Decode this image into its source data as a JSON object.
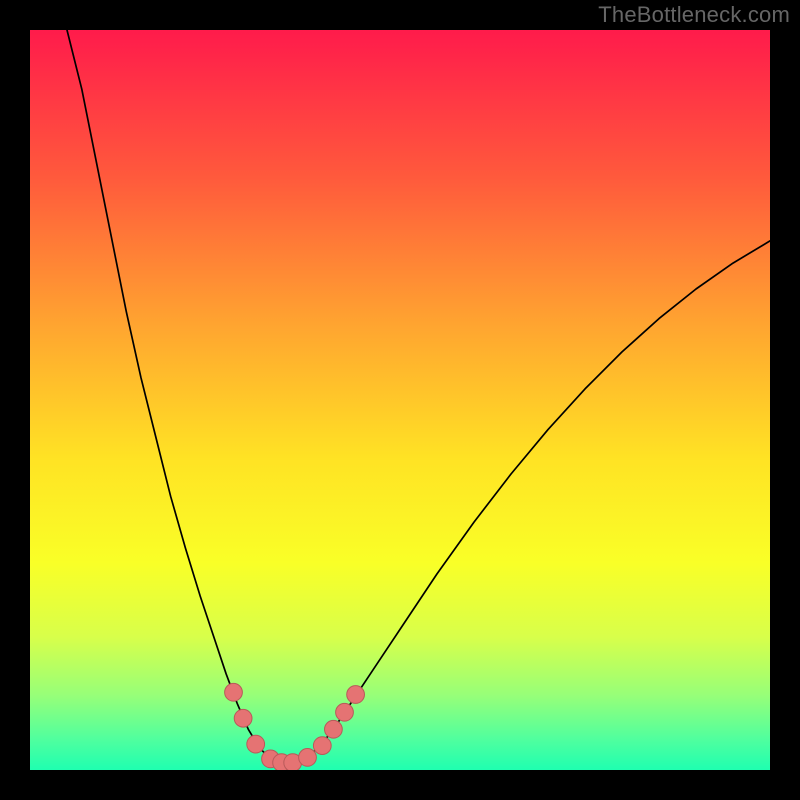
{
  "watermark": "TheBottleneck.com",
  "chart_data": {
    "type": "line",
    "title": "",
    "xlabel": "",
    "ylabel": "",
    "xlim": [
      0,
      100
    ],
    "ylim": [
      0,
      100
    ],
    "grid": false,
    "legend": false,
    "background_gradient": {
      "stops": [
        {
          "offset": 0.0,
          "color": "#ff1b4b"
        },
        {
          "offset": 0.2,
          "color": "#ff5a3c"
        },
        {
          "offset": 0.4,
          "color": "#ffa530"
        },
        {
          "offset": 0.58,
          "color": "#ffe324"
        },
        {
          "offset": 0.72,
          "color": "#f9ff27"
        },
        {
          "offset": 0.82,
          "color": "#d8ff4a"
        },
        {
          "offset": 0.9,
          "color": "#96ff79"
        },
        {
          "offset": 0.96,
          "color": "#4eff9f"
        },
        {
          "offset": 1.0,
          "color": "#1fffb0"
        }
      ]
    },
    "series": [
      {
        "name": "curve",
        "stroke": "#000000",
        "stroke_width": 1.7,
        "points": [
          {
            "x": 5.0,
            "y": 100.0
          },
          {
            "x": 7.0,
            "y": 92.0
          },
          {
            "x": 9.0,
            "y": 82.0
          },
          {
            "x": 11.0,
            "y": 72.0
          },
          {
            "x": 13.0,
            "y": 62.0
          },
          {
            "x": 15.0,
            "y": 53.0
          },
          {
            "x": 17.0,
            "y": 45.0
          },
          {
            "x": 19.0,
            "y": 37.0
          },
          {
            "x": 21.0,
            "y": 30.0
          },
          {
            "x": 23.0,
            "y": 23.5
          },
          {
            "x": 25.0,
            "y": 17.5
          },
          {
            "x": 26.5,
            "y": 13.0
          },
          {
            "x": 28.0,
            "y": 9.0
          },
          {
            "x": 29.5,
            "y": 5.5
          },
          {
            "x": 31.0,
            "y": 3.0
          },
          {
            "x": 32.5,
            "y": 1.5
          },
          {
            "x": 34.0,
            "y": 1.0
          },
          {
            "x": 35.5,
            "y": 1.0
          },
          {
            "x": 37.0,
            "y": 1.5
          },
          {
            "x": 39.0,
            "y": 3.0
          },
          {
            "x": 41.0,
            "y": 5.5
          },
          {
            "x": 43.0,
            "y": 8.5
          },
          {
            "x": 46.0,
            "y": 13.0
          },
          {
            "x": 50.0,
            "y": 19.0
          },
          {
            "x": 55.0,
            "y": 26.5
          },
          {
            "x": 60.0,
            "y": 33.5
          },
          {
            "x": 65.0,
            "y": 40.0
          },
          {
            "x": 70.0,
            "y": 46.0
          },
          {
            "x": 75.0,
            "y": 51.5
          },
          {
            "x": 80.0,
            "y": 56.5
          },
          {
            "x": 85.0,
            "y": 61.0
          },
          {
            "x": 90.0,
            "y": 65.0
          },
          {
            "x": 95.0,
            "y": 68.5
          },
          {
            "x": 100.0,
            "y": 71.5
          }
        ]
      }
    ],
    "markers": {
      "fill": "#e57373",
      "stroke": "#b85a5a",
      "radius": 1.2,
      "points": [
        {
          "x": 27.5,
          "y": 10.5
        },
        {
          "x": 28.8,
          "y": 7.0
        },
        {
          "x": 30.5,
          "y": 3.5
        },
        {
          "x": 32.5,
          "y": 1.5
        },
        {
          "x": 34.0,
          "y": 1.0
        },
        {
          "x": 35.5,
          "y": 1.0
        },
        {
          "x": 37.5,
          "y": 1.7
        },
        {
          "x": 39.5,
          "y": 3.3
        },
        {
          "x": 41.0,
          "y": 5.5
        },
        {
          "x": 42.5,
          "y": 7.8
        },
        {
          "x": 44.0,
          "y": 10.2
        }
      ]
    }
  }
}
